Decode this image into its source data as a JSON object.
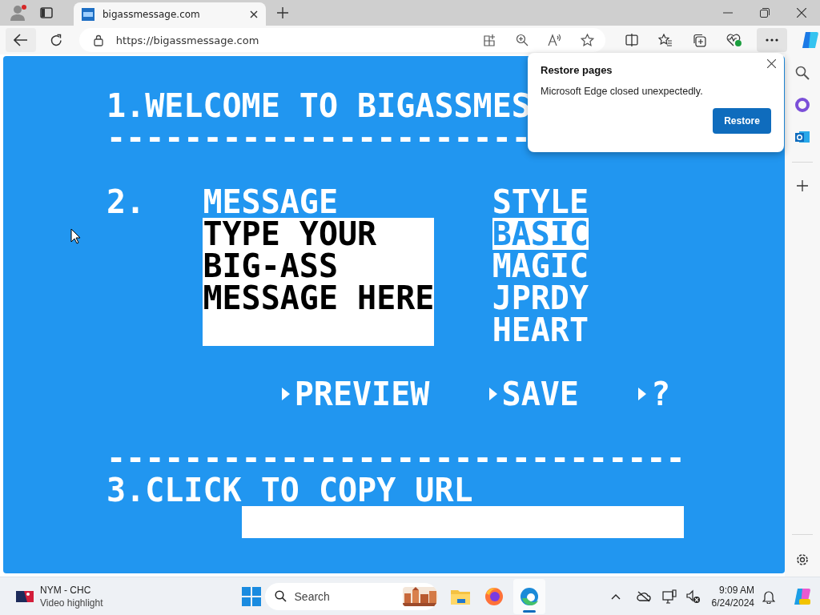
{
  "browser": {
    "tab_title": "bigassmessage.com",
    "address": "https://bigassmessage.com"
  },
  "page": {
    "section1": {
      "title": "1.WELCOME TO BIGASSMES",
      "rule": "----------------------"
    },
    "section2": {
      "number": "2.",
      "message_label": "MESSAGE",
      "message_placeholder": "TYPE YOUR BIG-ASS MESSAGE HERE",
      "style_label": "STYLE",
      "styles": [
        {
          "label": "BASIC",
          "selected": true
        },
        {
          "label": "MAGIC",
          "selected": false
        },
        {
          "label": "JPRDY",
          "selected": false
        },
        {
          "label": "HEART",
          "selected": false
        }
      ],
      "actions": [
        "PREVIEW",
        "SAVE",
        "?"
      ]
    },
    "rule": "------------------------------",
    "section3": {
      "title": "3.CLICK TO COPY URL"
    }
  },
  "popup": {
    "title": "Restore pages",
    "message": "Microsoft Edge closed unexpectedly.",
    "button": "Restore"
  },
  "taskbar": {
    "widget_title": "NYM - CHC",
    "widget_subtitle": "Video highlight",
    "search_placeholder": "Search",
    "time": "9:09 AM",
    "date": "6/24/2024"
  }
}
